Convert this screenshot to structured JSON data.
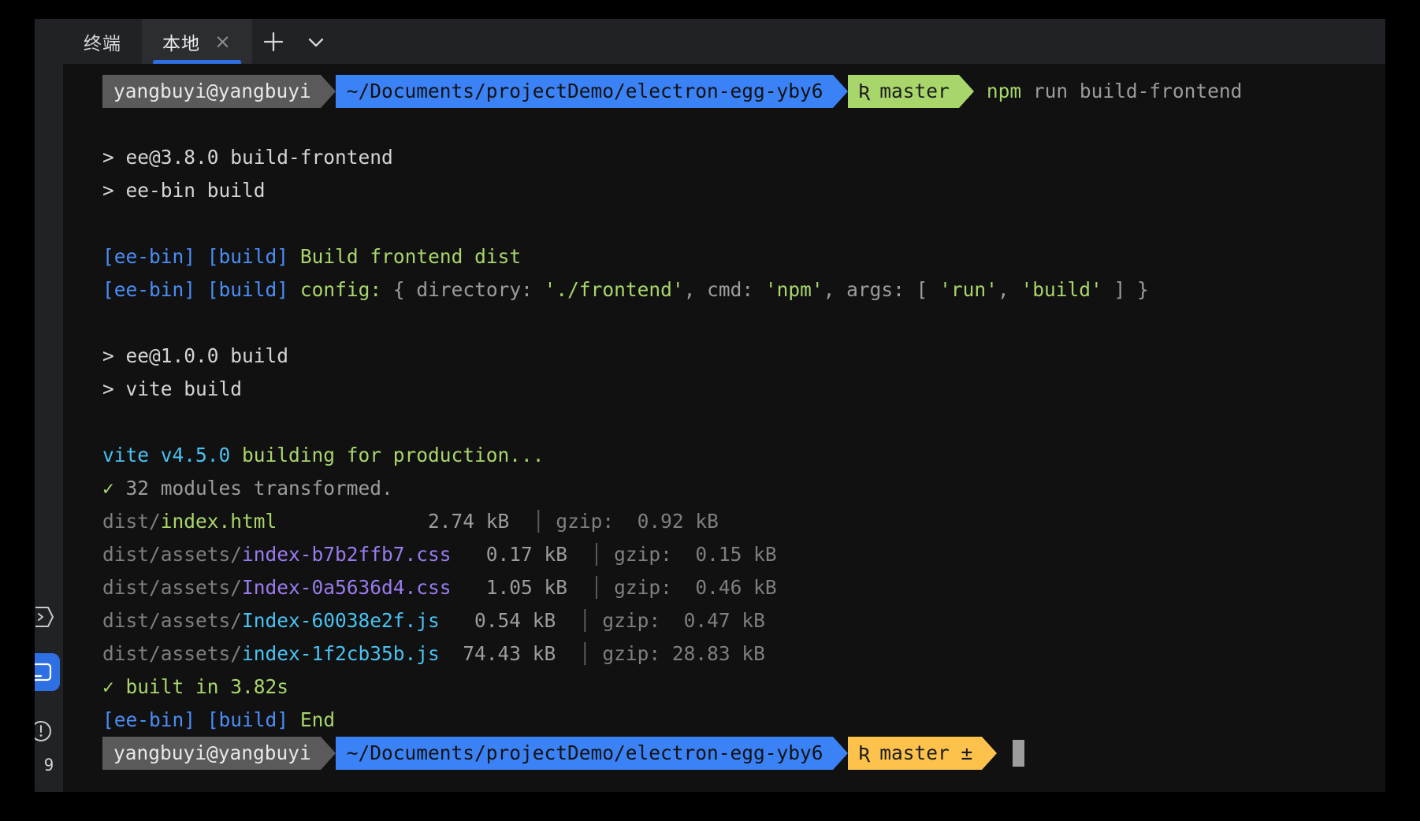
{
  "window": {
    "title": "terminal-window"
  },
  "tabs": {
    "items": [
      {
        "label": "终端",
        "active": false,
        "closable": false,
        "name": "tab-terminal"
      },
      {
        "label": "本地",
        "active": true,
        "closable": true,
        "name": "tab-local"
      }
    ],
    "close_glyph": "×",
    "new_tab_label": "new-tab",
    "dropdown_label": "tab-options"
  },
  "sidebar": {
    "icons": [
      {
        "name": "chevron-right-hex-icon",
        "active": false
      },
      {
        "name": "terminal-panel-icon",
        "active": true
      },
      {
        "name": "warning-circle-icon",
        "active": false
      }
    ],
    "badge": "9"
  },
  "colors": {
    "background": "#111111",
    "tabbar": "#212225",
    "accent": "#2f6fe4",
    "prompt_user_bg": "#5a5a5a",
    "prompt_path_bg": "#3b82f6",
    "prompt_git_running_bg": "#a9d66b",
    "prompt_git_done_bg": "#fcc24c",
    "green": "#a9d66b",
    "blue": "#4a8ef7",
    "cyan": "#49c2f2",
    "purple": "#9a7bf0",
    "gray": "#9b9c9d",
    "white": "#d4d5d6"
  },
  "terminal": {
    "prompt_top": {
      "user": "yangbuyi@yangbuyi",
      "path": "~/Documents/projectDemo/electron-egg-yby6",
      "git_icon": "Ʀ",
      "git_branch": "master",
      "command_program": "npm",
      "command_args": "run build-frontend"
    },
    "prompt_bottom": {
      "user": "yangbuyi@yangbuyi",
      "path": "~/Documents/projectDemo/electron-egg-yby6",
      "git_icon": "Ʀ",
      "git_branch": "master ±",
      "cursor": "block"
    },
    "lines": [
      {
        "type": "blank"
      },
      {
        "type": "plain",
        "text": "> ee@3.8.0 build-frontend"
      },
      {
        "type": "plain",
        "text": "> ee-bin build"
      },
      {
        "type": "blank"
      },
      {
        "type": "eebin",
        "tag1": "[ee-bin]",
        "tag2": "[build]",
        "message": "Build frontend dist"
      },
      {
        "type": "config",
        "tag1": "[ee-bin]",
        "tag2": "[build]",
        "key": "config:",
        "open": " { directory: ",
        "v1": "'./frontend'",
        "mid1": ", cmd: ",
        "v2": "'npm'",
        "mid2": ", args: [ ",
        "v3": "'run'",
        "mid3": ", ",
        "v4": "'build'",
        "close": " ] }"
      },
      {
        "type": "blank"
      },
      {
        "type": "plain",
        "text": "> ee@1.0.0 build"
      },
      {
        "type": "plain",
        "text": "> vite build"
      },
      {
        "type": "blank"
      },
      {
        "type": "vite",
        "name": "vite",
        "version": " v4.5.0",
        "message": " building for production..."
      },
      {
        "type": "check",
        "mark": "✓",
        "text": " 32 modules transformed.",
        "color": "gray"
      }
    ],
    "dist_header": null,
    "dist_files": [
      {
        "dir": "dist/",
        "file": "index.html",
        "file_color": "green",
        "size": "2.74 kB",
        "gzip_label": "gzip:",
        "gzip": " 0.92 kB"
      },
      {
        "dir": "dist/assets/",
        "file": "index-b7b2ffb7.css",
        "file_color": "purple",
        "size": "0.17 kB",
        "gzip_label": "gzip:",
        "gzip": " 0.15 kB"
      },
      {
        "dir": "dist/assets/",
        "file": "Index-0a5636d4.css",
        "file_color": "purple",
        "size": "1.05 kB",
        "gzip_label": "gzip:",
        "gzip": " 0.46 kB"
      },
      {
        "dir": "dist/assets/",
        "file": "Index-60038e2f.js",
        "file_color": "cyan",
        "size": "0.54 kB",
        "gzip_label": "gzip:",
        "gzip": " 0.47 kB"
      },
      {
        "dir": "dist/assets/",
        "file": "index-1f2cb35b.js",
        "file_color": "cyan",
        "size": "74.43 kB",
        "gzip_label": "gzip:",
        "gzip": "28.83 kB"
      }
    ],
    "tail_lines": [
      {
        "type": "check",
        "mark": "✓",
        "text": " built in 3.82s",
        "color": "green"
      },
      {
        "type": "eebin",
        "tag1": "[ee-bin]",
        "tag2": "[build]",
        "message": "End"
      }
    ]
  }
}
